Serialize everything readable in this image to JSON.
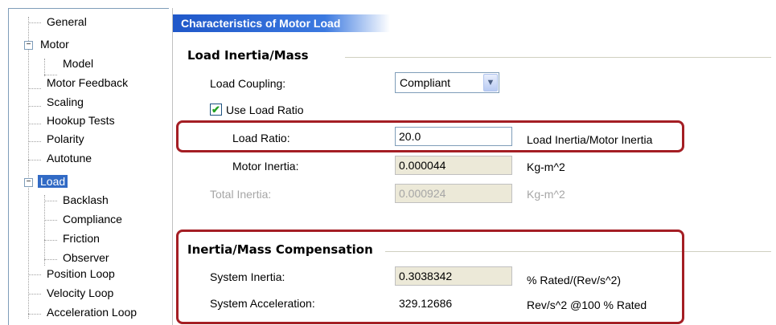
{
  "tree": {
    "items": [
      {
        "label": "General"
      },
      {
        "label": "Motor"
      },
      {
        "label": "Model"
      },
      {
        "label": "Motor Feedback"
      },
      {
        "label": "Scaling"
      },
      {
        "label": "Hookup Tests"
      },
      {
        "label": "Polarity"
      },
      {
        "label": "Autotune"
      },
      {
        "label": "Load"
      },
      {
        "label": "Backlash"
      },
      {
        "label": "Compliance"
      },
      {
        "label": "Friction"
      },
      {
        "label": "Observer"
      },
      {
        "label": "Position Loop"
      },
      {
        "label": "Velocity Loop"
      },
      {
        "label": "Acceleration Loop"
      }
    ],
    "selected": "Load",
    "expander_minus": "−"
  },
  "panel": {
    "title": "Characteristics of Motor Load",
    "load_group": {
      "title": "Load Inertia/Mass",
      "coupling_label": "Load Coupling:",
      "coupling_value": "Compliant",
      "use_ratio_label": "Use Load Ratio",
      "use_ratio_checked": "✔",
      "ratio_label": "Load Ratio:",
      "ratio_value": "20.0",
      "ratio_units": "Load Inertia/Motor Inertia",
      "motor_inertia_label": "Motor Inertia:",
      "motor_inertia_value": "0.000044",
      "motor_inertia_units": "Kg-m^2",
      "total_inertia_label": "Total Inertia:",
      "total_inertia_value": "0.000924",
      "total_inertia_units": "Kg-m^2"
    },
    "comp_group": {
      "title": "Inertia/Mass Compensation",
      "sys_inertia_label": "System Inertia:",
      "sys_inertia_value": "0.3038342",
      "sys_inertia_units": "% Rated/(Rev/s^2)",
      "sys_accel_label": "System Acceleration:",
      "sys_accel_value": "329.12686",
      "sys_accel_units": "Rev/s^2 @100 % Rated"
    }
  },
  "colors": {
    "highlight": "#a41e24",
    "header": "#1f57c9",
    "selection": "#316ac5"
  }
}
